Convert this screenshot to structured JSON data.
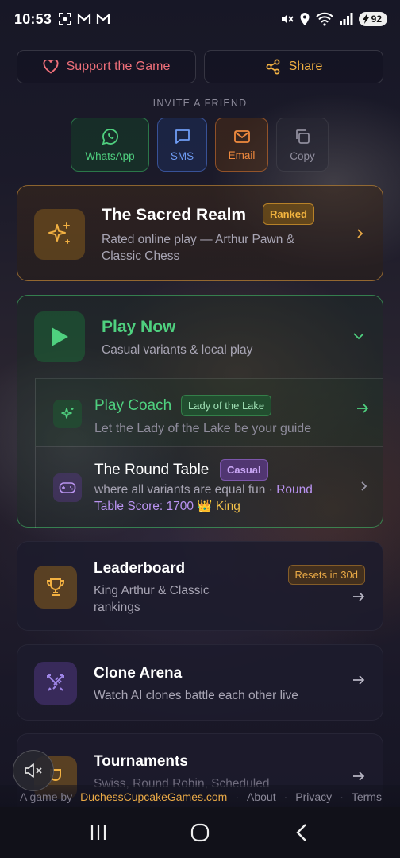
{
  "status_bar": {
    "time": "10:53",
    "battery": "92",
    "signal_label": "6"
  },
  "header": {
    "support_label": "Support the Game",
    "share_label": "Share",
    "invite_label": "INVITE A FRIEND",
    "share_options": [
      {
        "label": "WhatsApp"
      },
      {
        "label": "SMS"
      },
      {
        "label": "Email"
      },
      {
        "label": "Copy"
      }
    ]
  },
  "realm": {
    "title": "The Sacred Realm",
    "badge": "Ranked",
    "subtitle": "Rated online play — Arthur Pawn & Classic Chess"
  },
  "play_now": {
    "title": "Play Now",
    "subtitle": "Casual variants & local play",
    "coach": {
      "title": "Play Coach",
      "badge": "Lady of the Lake",
      "subtitle": "Let the Lady of the Lake be your guide"
    },
    "round_table": {
      "title": "The Round Table",
      "badge": "Casual",
      "subtitle_prefix": "where all variants are equal fun · ",
      "score_label": "Round Table Score: 1700",
      "rank_label": "👑 King"
    }
  },
  "leaderboard": {
    "title": "Leaderboard",
    "subtitle": "King Arthur & Classic rankings",
    "badge": "Resets in 30d"
  },
  "clone_arena": {
    "title": "Clone Arena",
    "subtitle": "Watch AI clones battle each other live"
  },
  "tournaments": {
    "title": "Tournaments",
    "subtitle": "Swiss, Round Robin, Scheduled"
  },
  "footer": {
    "prefix": "A game by",
    "studio": "DuchessCupcakeGames.com",
    "about": "About",
    "privacy": "Privacy",
    "terms": "Terms",
    "separator": "·"
  },
  "colors": {
    "gold": "#f2b142",
    "green": "#4fd07f",
    "purple": "#b993f0",
    "red": "#f0707a"
  }
}
